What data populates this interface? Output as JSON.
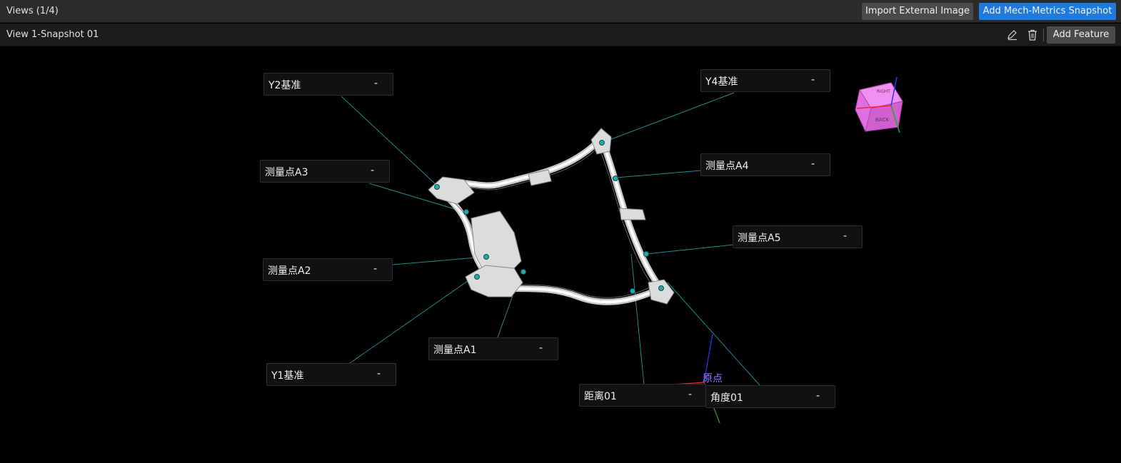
{
  "header": {
    "title": "Views (1/4)",
    "import_label": "Import External Image",
    "add_snapshot_label": "Add Mech-Metrics Snapshot"
  },
  "view": {
    "title": "View 1-Snapshot 01",
    "add_feature_label": "Add Feature",
    "edit_icon": "pencil-icon",
    "delete_icon": "trash-icon"
  },
  "labels": [
    {
      "id": "y2",
      "name": "Y2基准",
      "value": "-"
    },
    {
      "id": "y4",
      "name": "Y4基准",
      "value": "-"
    },
    {
      "id": "a3",
      "name": "测量点A3",
      "value": "-"
    },
    {
      "id": "a4",
      "name": "测量点A4",
      "value": "-"
    },
    {
      "id": "a5",
      "name": "测量点A5",
      "value": "-"
    },
    {
      "id": "a2",
      "name": "测量点A2",
      "value": "-"
    },
    {
      "id": "a1",
      "name": "测量点A1",
      "value": "-"
    },
    {
      "id": "y1",
      "name": "Y1基准",
      "value": "-"
    },
    {
      "id": "d01",
      "name": "距离01",
      "value": "-"
    },
    {
      "id": "ang01",
      "name": "角度01",
      "value": "-"
    }
  ],
  "origin_label": "原点",
  "view_cube": {
    "face_top": "RIGHT",
    "face_front": "BACK"
  },
  "colors": {
    "accent": "#1f7ae0",
    "leader": "#1e8a8a",
    "cube": "#e070e0"
  }
}
